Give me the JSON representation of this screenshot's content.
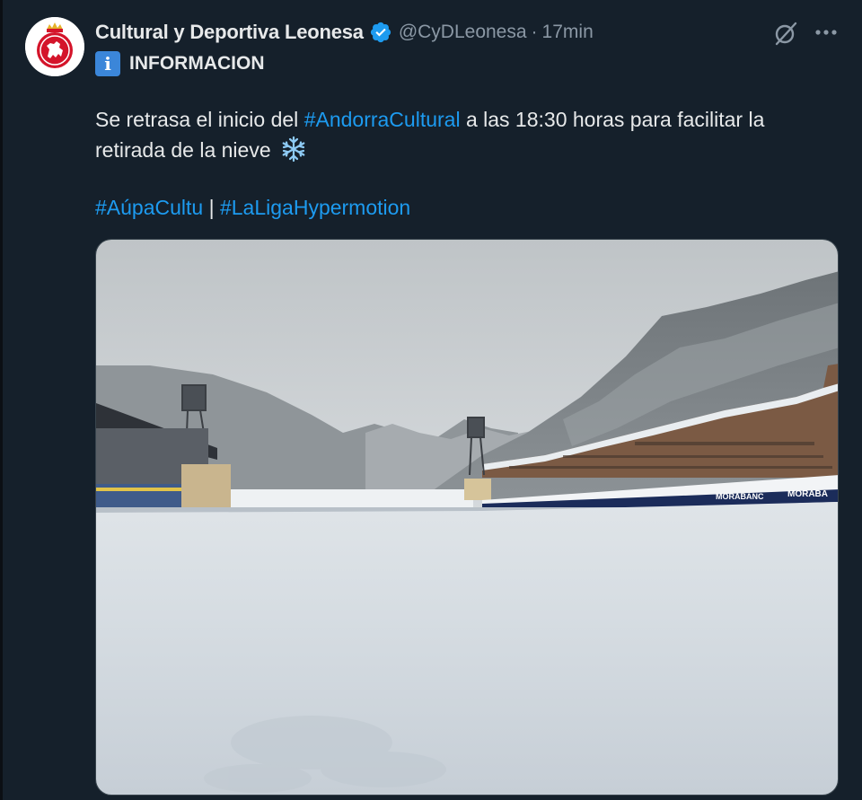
{
  "author": {
    "display_name": "Cultural y Deportiva Leonesa",
    "handle": "@CyDLeonesa",
    "separator": "·",
    "time": "17min",
    "verified": true
  },
  "label": {
    "badge_glyph": "i",
    "text": "INFORMACION"
  },
  "tweet": {
    "line1_prefix": "Se retrasa el inicio del ",
    "line1_hashtag": "#AndorraCultural",
    "line1_suffix": " a las 18:30 horas para facilitar la",
    "line2": "retirada de la nieve",
    "hashtag_a": "#AúpaCultu",
    "divider": "|",
    "hashtag_b": "#LaLigaHypermotion"
  },
  "media": {
    "ad_board_text_1": "MORABANC",
    "ad_board_text_2": "MORABA"
  },
  "icons": {
    "verified": "verified-badge-icon",
    "grok": "grok-icon",
    "more": "more-icon",
    "snowflake": "snowflake-icon"
  },
  "colors": {
    "background": "#15202b",
    "text": "#e7e9ea",
    "secondary": "#8b98a5",
    "link": "#1d9bf0",
    "badge": "#3b86d9"
  }
}
